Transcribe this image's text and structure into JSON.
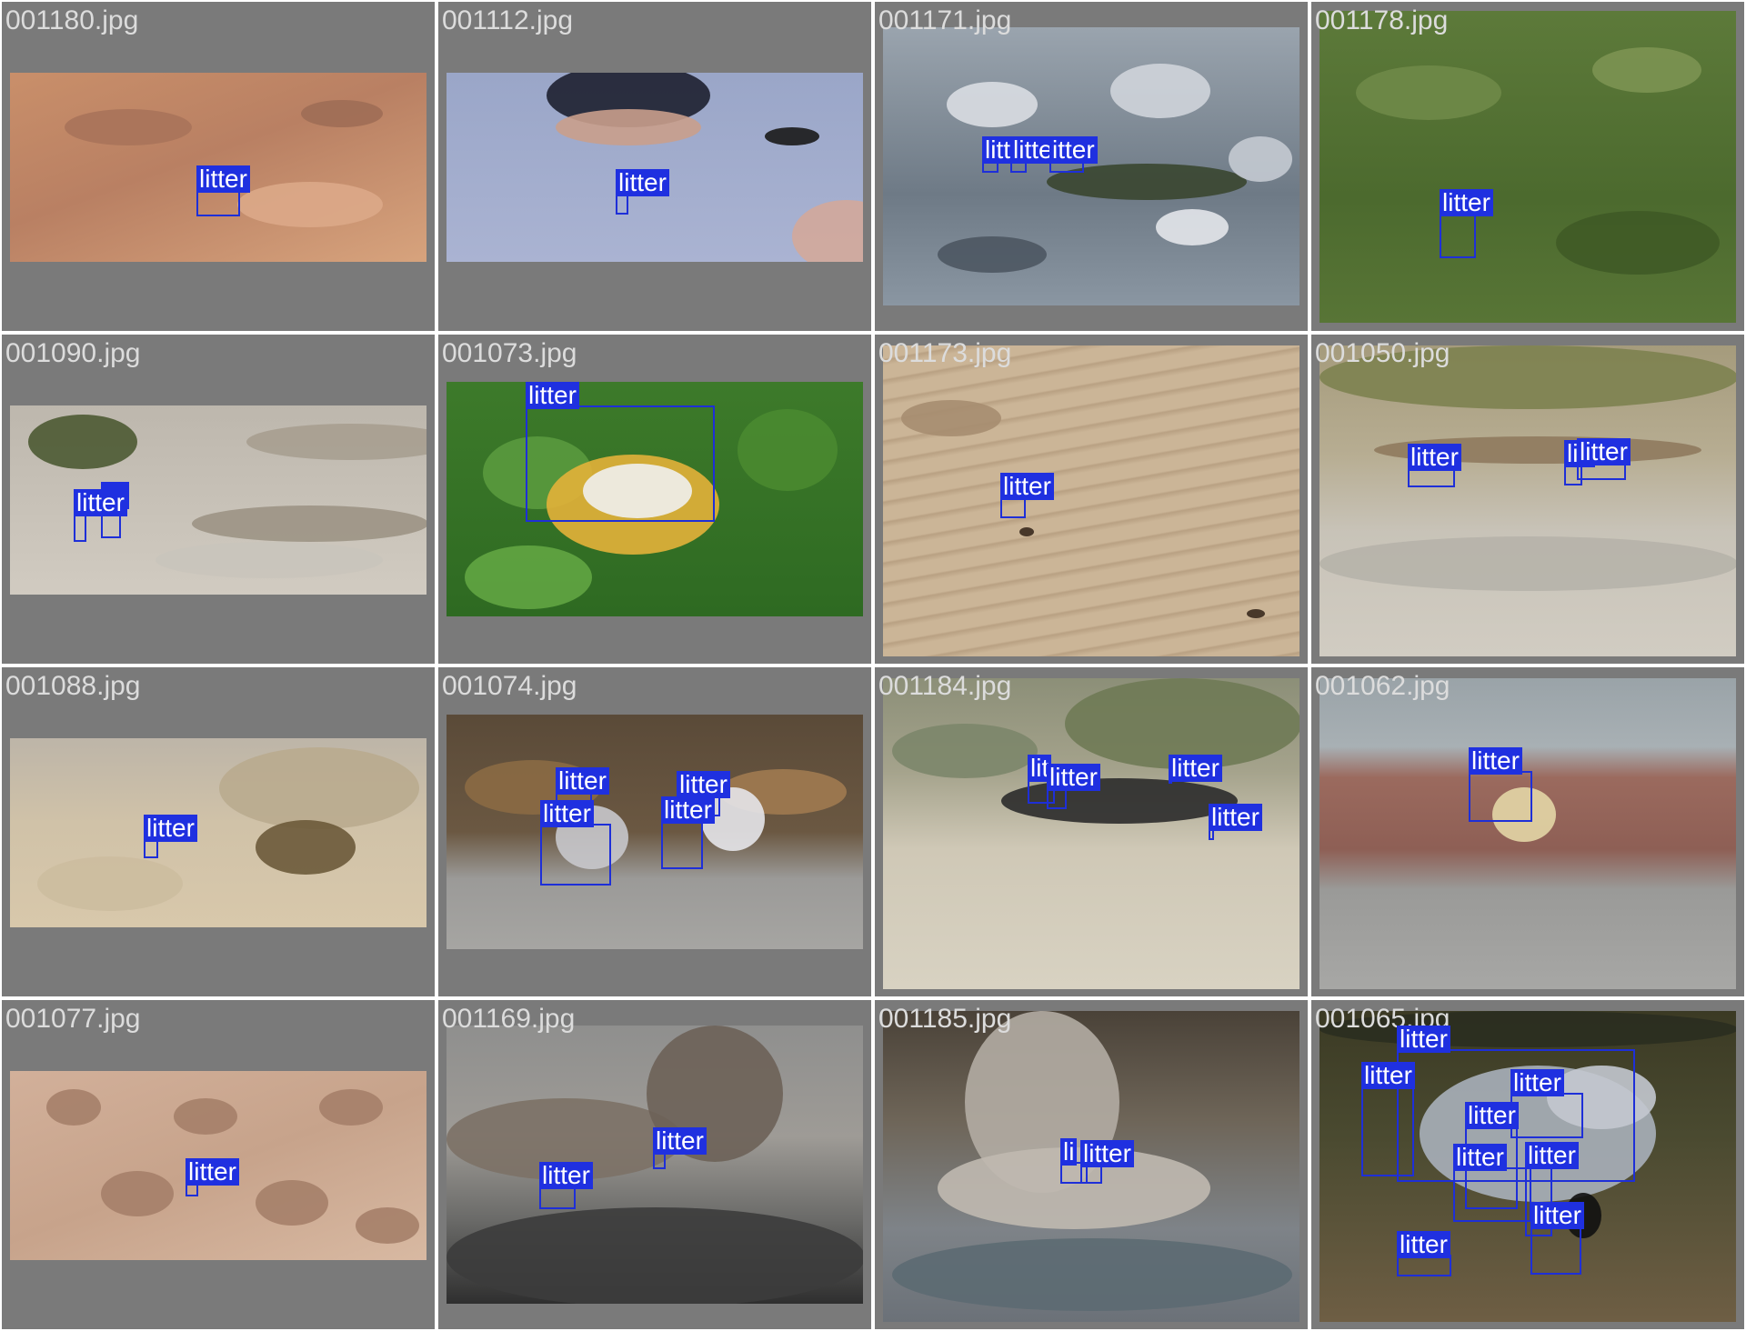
{
  "colors": {
    "tile_background": "#7a7a7a",
    "box_color": "#1e2fd8",
    "label_background": "#1f30e0",
    "label_text": "#ffffff",
    "filename_text": "#dcdcdc"
  },
  "tiles": [
    {
      "filename": "001180.jpg",
      "scene": "sand",
      "detections": [
        {
          "label": "litter"
        }
      ]
    },
    {
      "filename": "001112.jpg",
      "scene": "pavement-with-feet",
      "detections": [
        {
          "label": "litter"
        }
      ]
    },
    {
      "filename": "001171.jpg",
      "scene": "rocks",
      "detections": [
        {
          "label": "litte"
        },
        {
          "label": "litter"
        },
        {
          "label": "itter"
        }
      ]
    },
    {
      "filename": "001178.jpg",
      "scene": "grass",
      "detections": [
        {
          "label": "litter"
        }
      ]
    },
    {
      "filename": "001090.jpg",
      "scene": "sand-with-log",
      "detections": [
        {
          "label": "er"
        },
        {
          "label": "litter"
        }
      ]
    },
    {
      "filename": "001073.jpg",
      "scene": "green-plants",
      "detections": [
        {
          "label": "litter"
        }
      ]
    },
    {
      "filename": "001173.jpg",
      "scene": "rippled-sand",
      "detections": [
        {
          "label": "litter"
        }
      ]
    },
    {
      "filename": "001050.jpg",
      "scene": "dry-grass-path",
      "detections": [
        {
          "label": "litter"
        },
        {
          "label": "litt"
        },
        {
          "label": "litter"
        }
      ]
    },
    {
      "filename": "001088.jpg",
      "scene": "beach-sand",
      "detections": [
        {
          "label": "litter"
        }
      ]
    },
    {
      "filename": "001074.jpg",
      "scene": "leaves-on-asphalt",
      "detections": [
        {
          "label": "litter"
        },
        {
          "label": "litter"
        },
        {
          "label": "litter"
        },
        {
          "label": "litter"
        }
      ]
    },
    {
      "filename": "001184.jpg",
      "scene": "scrubland",
      "detections": [
        {
          "label": "lit"
        },
        {
          "label": "litter"
        },
        {
          "label": "litter"
        },
        {
          "label": "litter"
        }
      ]
    },
    {
      "filename": "001062.jpg",
      "scene": "brick-path",
      "detections": [
        {
          "label": "litter"
        }
      ]
    },
    {
      "filename": "001077.jpg",
      "scene": "footprint-sand",
      "detections": [
        {
          "label": "litter"
        }
      ]
    },
    {
      "filename": "001169.jpg",
      "scene": "palm-trunks",
      "detections": [
        {
          "label": "litter"
        },
        {
          "label": "litter"
        }
      ]
    },
    {
      "filename": "001185.jpg",
      "scene": "tree-roots",
      "detections": [
        {
          "label": "li"
        },
        {
          "label": "litter"
        }
      ]
    },
    {
      "filename": "001065.jpg",
      "scene": "night-ground",
      "detections": [
        {
          "label": "litter"
        },
        {
          "label": "litter"
        },
        {
          "label": "litter"
        },
        {
          "label": "litter"
        },
        {
          "label": "litter"
        },
        {
          "label": "litter"
        },
        {
          "label": "litter"
        },
        {
          "label": "litter"
        }
      ]
    }
  ]
}
